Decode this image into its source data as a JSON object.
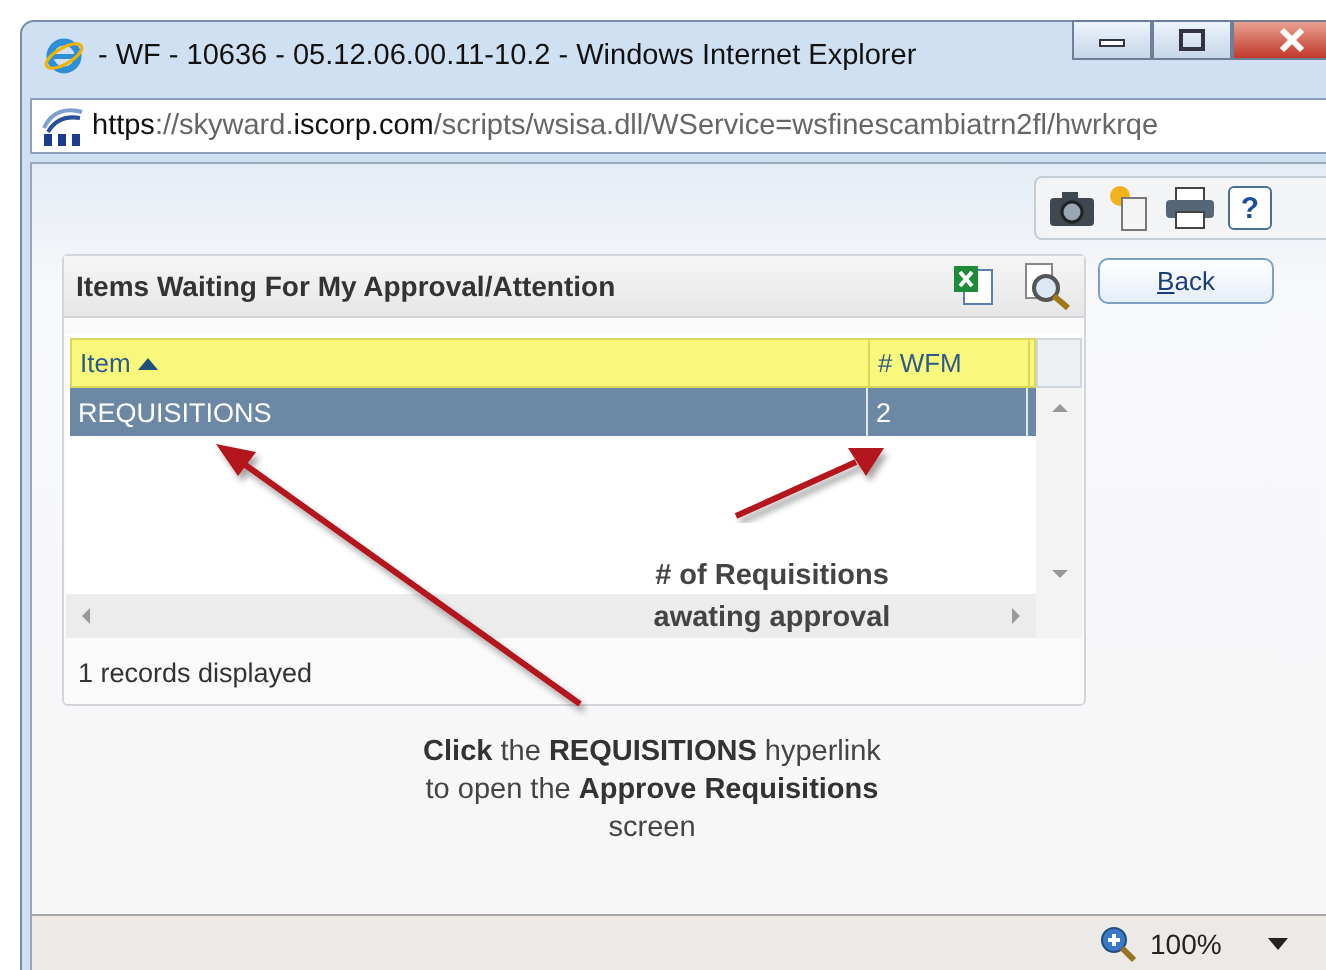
{
  "window": {
    "title": "- WF - 10636 - 05.12.06.00.11-10.2 - Windows Internet Explorer"
  },
  "address_bar": {
    "scheme": "https://skyward.",
    "domain": "iscorp.com",
    "path": "/scripts/wsisa.dll/WService=wsfinescambiatrn2fl/hwrkrqe"
  },
  "toolbar": {
    "help_button": "?"
  },
  "panel": {
    "title": "Items Waiting For My Approval/Attention",
    "back_button": "Back",
    "table": {
      "columns": [
        {
          "label": "Item",
          "sorted": true
        },
        {
          "label": "# WFM",
          "sorted": false
        }
      ],
      "rows": [
        {
          "cells": [
            "REQUISITIONS",
            "2"
          ],
          "selected": true
        }
      ]
    },
    "footer": "1 records displayed"
  },
  "annotations": [
    {
      "kind": "callout",
      "text": "# of Requisitions awating approval"
    },
    {
      "kind": "caption",
      "text": "**Click** the **REQUISITIONS** hyperlink to open the **Approve Requisitions** screen"
    }
  ],
  "status_bar": {
    "zoom": "100%"
  }
}
